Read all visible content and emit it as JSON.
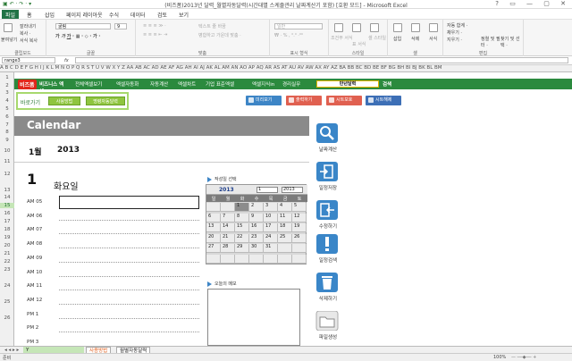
{
  "window": {
    "title": "(비즈폼)2013년 달력_월별자동달력(시간대별 스케줄관리 날짜계산기 포함) [호환 모드] - Microsoft Excel",
    "controls": "? ▭ — ▢ ✕"
  },
  "ribbon_tabs": [
    "파일",
    "홈",
    "삽입",
    "페이지 레이아웃",
    "수식",
    "데이터",
    "검토",
    "보기"
  ],
  "ribbon": {
    "paste": "붙여넣기",
    "cut": "잘라내기",
    "copy": "복사 ·",
    "format_painter": "서식 복사",
    "clipboard": "클립보드",
    "font_name": "굴림",
    "font_size": "9",
    "font_group": "글꼴",
    "wrap": "텍스트 줄 바꿈",
    "merge": "병합하고 가운데 맞춤 ·",
    "align_group": "맞춤",
    "number_format": "일반",
    "number_group": "표시 형식",
    "cond_format": "조건부 서식",
    "table_format": "표 서식",
    "cell_style": "셀 스타일",
    "style_group": "스타일",
    "insert": "삽입",
    "delete": "삭제",
    "format": "서식",
    "cells_group": "셀",
    "autosum": "자동 합계 ·",
    "fill": "채우기 ·",
    "clear": "지우기 ·",
    "sort": "정렬 및 필터 ·",
    "find": "찾기 및 선택 ·",
    "edit_group": "편집"
  },
  "name_box": "range3",
  "formula_fx": "fx",
  "col_header": "A B C D E F G H I J K L M N O P Q R S T U V W X Y Z AA AB AC AD AE AF AG AH AI AJ AK AL AM AN AO AP AQ AR AS AT AU AV AW AX AY AZ BA BB BC BD BE BF BG BH BI BJ BK BL BM",
  "row_headers": [
    "1",
    "2",
    "3",
    "4",
    "5",
    "6",
    "7",
    "8",
    "9",
    "10",
    "11",
    "12",
    "13",
    "14",
    "15",
    "16",
    "17",
    "18",
    "19",
    "20",
    "21",
    "22",
    "23",
    "24",
    "25",
    "26"
  ],
  "greenbar": {
    "logo": "비즈폼",
    "brand": "비즈니스 엑셀",
    "items": [
      "전체엑셀보기",
      "엑셀자동화",
      "자동계산",
      "엑셀차트",
      "기업 표준엑셀",
      "엑셀지식in",
      "경리실무"
    ],
    "search_value": "만년달력",
    "search_button": "검색"
  },
  "shortcut": {
    "label": "바로가기",
    "buttons": [
      "사용방법",
      "명령자동달력"
    ]
  },
  "top_buttons": [
    "미리보기",
    "출력하기",
    "시트보호",
    "시트해제"
  ],
  "top_button_colors": [
    "#3d85c6",
    "#e06050",
    "#e06050",
    "#3d6fb6"
  ],
  "calendar": {
    "title": "Calendar",
    "month": "1월",
    "year": "2013",
    "day": "1",
    "weekday": "화요일"
  },
  "schedule_slots": [
    "AM 05",
    "AM 06",
    "AM 07",
    "AM 08",
    "AM 09",
    "AM 10",
    "AM 11",
    "AM 12",
    "PM 1",
    "PM 2",
    "PM 3"
  ],
  "minical": {
    "header": "작성일 선택",
    "year": "2013",
    "month_select": "1",
    "year_select": "2013",
    "weekdays": [
      "일",
      "월",
      "화",
      "수",
      "목",
      "금",
      "토"
    ],
    "days": [
      [
        "",
        "",
        "1",
        "2",
        "3",
        "4",
        "5"
      ],
      [
        "6",
        "7",
        "8",
        "9",
        "10",
        "11",
        "12"
      ],
      [
        "13",
        "14",
        "15",
        "16",
        "17",
        "18",
        "19"
      ],
      [
        "20",
        "21",
        "22",
        "23",
        "24",
        "25",
        "26"
      ],
      [
        "27",
        "28",
        "29",
        "30",
        "31",
        "",
        ""
      ],
      [
        "",
        "",
        "",
        "",
        "",
        "",
        ""
      ]
    ],
    "today": "1"
  },
  "memo": {
    "header": "오늘의 메모"
  },
  "side_actions": [
    "날짜계산",
    "일정저장",
    "수정하기",
    "일정검색",
    "삭제하기",
    "파일생성"
  ],
  "sheet_tabs": [
    "Y",
    "사용방법",
    "월별자동달력"
  ],
  "status": {
    "ready": "준비",
    "zoom": "100%"
  }
}
